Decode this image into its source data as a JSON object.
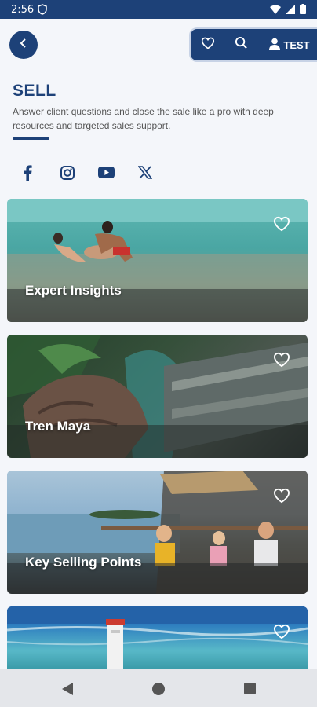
{
  "status": {
    "time": "2:56"
  },
  "header": {
    "user_label": "TEST"
  },
  "page": {
    "title": "SELL",
    "subtitle": "Answer client questions and close the sale like a pro with deep resources and targeted sales support."
  },
  "social": [
    "facebook-icon",
    "instagram-icon",
    "youtube-icon",
    "x-icon"
  ],
  "cards": [
    {
      "label": "Expert Insights"
    },
    {
      "label": "Tren Maya"
    },
    {
      "label": "Key Selling Points"
    },
    {
      "label": ""
    }
  ],
  "colors": {
    "brand": "#1d4178",
    "background": "#f4f6fa"
  }
}
